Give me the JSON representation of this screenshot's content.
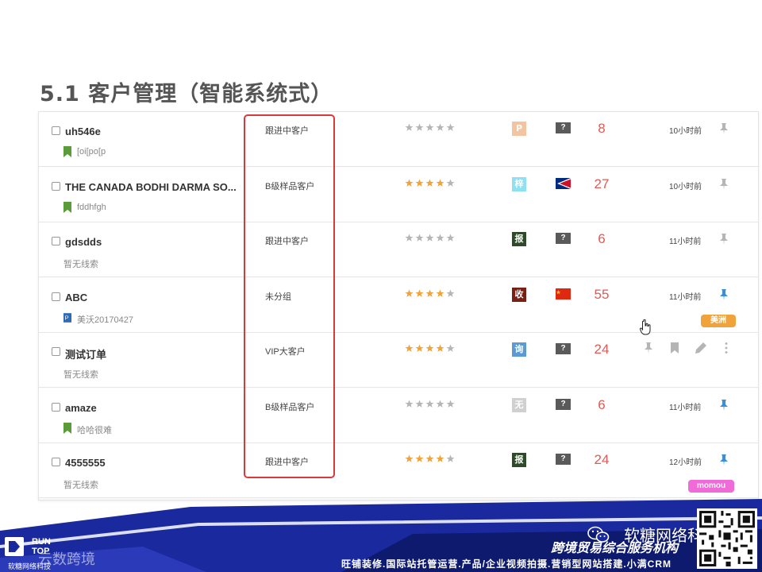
{
  "title": "5.1 客户管理（智能系统式）",
  "rows": [
    {
      "name": "uh546e",
      "lead": "[oi[po[p",
      "lead_icon": "green-bookmark-icon",
      "group": "跟进中客户",
      "stars": 0,
      "source": "P",
      "source_color": "#f3c4a2",
      "country": "unknown",
      "count": "8",
      "time": "10小时前",
      "pinned": false
    },
    {
      "name": "THE CANADA BODHI DARMA SO...",
      "lead": "fddhfgh",
      "lead_icon": "green-bookmark-icon",
      "group": "B级样品客户",
      "stars": 4,
      "source": "梓",
      "source_color": "#8fe0f0",
      "country": "american-samoa",
      "count": "27",
      "time": "10小时前",
      "pinned": false
    },
    {
      "name": "gdsdds",
      "lead": "暂无线索",
      "lead_icon": "",
      "group": "跟进中客户",
      "stars": 0,
      "source": "报",
      "source_color": "#2f4a29",
      "country": "unknown",
      "count": "6",
      "time": "11小时前",
      "pinned": false
    },
    {
      "name": "ABC",
      "lead": "美沃20170427",
      "lead_icon": "blue-p-icon",
      "group": "未分组",
      "stars": 4,
      "source": "收",
      "source_color": "#7a1f14",
      "country": "china",
      "count": "55",
      "time": "11小时前",
      "pinned": true,
      "tag": "美洲",
      "tag_color": "#f0a33a"
    },
    {
      "name": "测试订单",
      "lead": "暂无线索",
      "lead_icon": "",
      "group": "VIP大客户",
      "stars": 4,
      "source": "询",
      "source_color": "#5b9bd5",
      "country": "unknown",
      "count": "24",
      "time": "",
      "pinned": false,
      "hover_actions": true
    },
    {
      "name": "amaze",
      "lead": "哈哈很难",
      "lead_icon": "green-bookmark-icon",
      "group": "B级样品客户",
      "stars": 0,
      "source": "无",
      "source_color": "#d0d0d0",
      "country": "unknown",
      "count": "6",
      "time": "11小时前",
      "pinned": true
    },
    {
      "name": "4555555",
      "lead": "暂无线索",
      "lead_icon": "",
      "group": "跟进中客户",
      "stars": 4,
      "source": "报",
      "source_color": "#2f4a29",
      "country": "unknown",
      "count": "24",
      "time": "12小时前",
      "pinned": true,
      "tag": "momou",
      "tag_color": "#f06ad8"
    }
  ],
  "country_unknown_label": "?",
  "colors": {
    "star_on": "#f0a33a",
    "star_off": "#b5b5b5",
    "pin_on": "#3a8fd8",
    "pin_off": "#b5b5b5",
    "highlight": "#d83a3a",
    "count": "#e05a55",
    "footer_blue": "#1a2a9e"
  },
  "footer": {
    "logo_line1": "RUN",
    "logo_line2": "TOP",
    "logo_sub": "软糖网络科技",
    "left_watermark": "云数跨境",
    "wechat_name": "软糖网络科技",
    "slogan": "跨境贸易综合服务机构",
    "services": "旺铺装修.国际站托管运营.产品/企业视频拍摄.营销型网站搭建.小满CRM"
  }
}
